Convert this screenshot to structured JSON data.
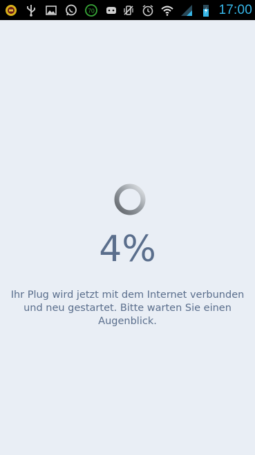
{
  "status_bar": {
    "time": "17:00",
    "colors": {
      "background": "#000000",
      "time": "#36b6e8",
      "signal": "#36b6e8",
      "battery": "#36b6e8"
    },
    "left_icons": [
      "sync-notification-icon",
      "usb-icon",
      "image-notification-icon",
      "whatsapp-icon",
      "counter-70-icon",
      "game-controller-icon"
    ],
    "counter_badge": "70",
    "right_icons": [
      "vibrate-mute-icon",
      "alarm-icon",
      "wifi-icon",
      "signal-icon",
      "battery-charging-icon"
    ]
  },
  "main": {
    "spinner_icon": "loading-spinner-icon",
    "progress_percent": "4%",
    "message": "Ihr Plug wird jetzt mit dem Internet verbunden und neu gestartet. Bitte warten Sie einen Augenblick.",
    "colors": {
      "background": "#e9eef5",
      "text": "#5a6e8c"
    }
  }
}
